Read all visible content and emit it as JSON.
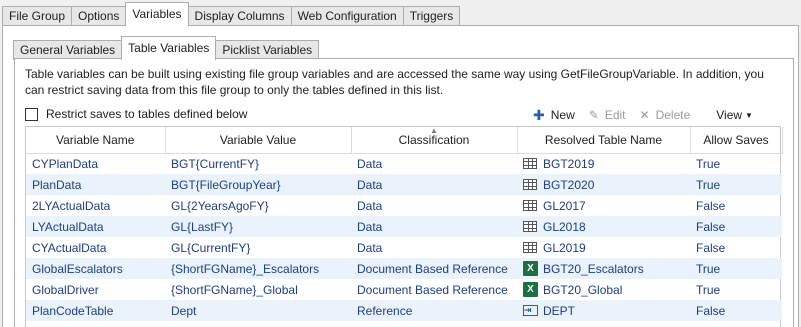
{
  "top_tabs": [
    "File Group",
    "Options",
    "Variables",
    "Display Columns",
    "Web Configuration",
    "Triggers"
  ],
  "sub_tabs": [
    "General Variables",
    "Table Variables",
    "Picklist Variables"
  ],
  "description": "Table variables can be built using existing file group variables and are accessed the same way using GetFileGroupVariable. In addition, you can restrict saving data from this file group to only the tables defined in this list.",
  "restrict_label": "Restrict saves to tables defined below",
  "toolbar": {
    "new": "New",
    "edit": "Edit",
    "delete": "Delete",
    "view": "View"
  },
  "columns": [
    "Variable Name",
    "Variable Value",
    "Classification",
    "Resolved Table Name",
    "Allow Saves"
  ],
  "rows": [
    {
      "name": "CYPlanData",
      "value": "BGT{CurrentFY}",
      "classification": "Data",
      "resolved": "BGT2019",
      "icon": "table-icon",
      "allow": "True"
    },
    {
      "name": "PlanData",
      "value": "BGT{FileGroupYear}",
      "classification": "Data",
      "resolved": "BGT2020",
      "icon": "table-icon",
      "allow": "True"
    },
    {
      "name": "2LYActualData",
      "value": "GL{2YearsAgoFY}",
      "classification": "Data",
      "resolved": "GL2017",
      "icon": "table-icon",
      "allow": "False"
    },
    {
      "name": "LYActualData",
      "value": "GL{LastFY}",
      "classification": "Data",
      "resolved": "GL2018",
      "icon": "table-icon",
      "allow": "False"
    },
    {
      "name": "CYActualData",
      "value": "GL{CurrentFY}",
      "classification": "Data",
      "resolved": "GL2019",
      "icon": "table-icon",
      "allow": "False"
    },
    {
      "name": "GlobalEscalators",
      "value": "{ShortFGName}_Escalators",
      "classification": "Document Based Reference",
      "resolved": "BGT20_Escalators",
      "icon": "excel-icon",
      "allow": "True"
    },
    {
      "name": "GlobalDriver",
      "value": "{ShortFGName}_Global",
      "classification": "Document Based Reference",
      "resolved": "BGT20_Global",
      "icon": "excel-icon",
      "allow": "True"
    },
    {
      "name": "PlanCodeTable",
      "value": "Dept",
      "classification": "Reference",
      "resolved": "DEPT",
      "icon": "reference-icon",
      "allow": "False"
    }
  ]
}
